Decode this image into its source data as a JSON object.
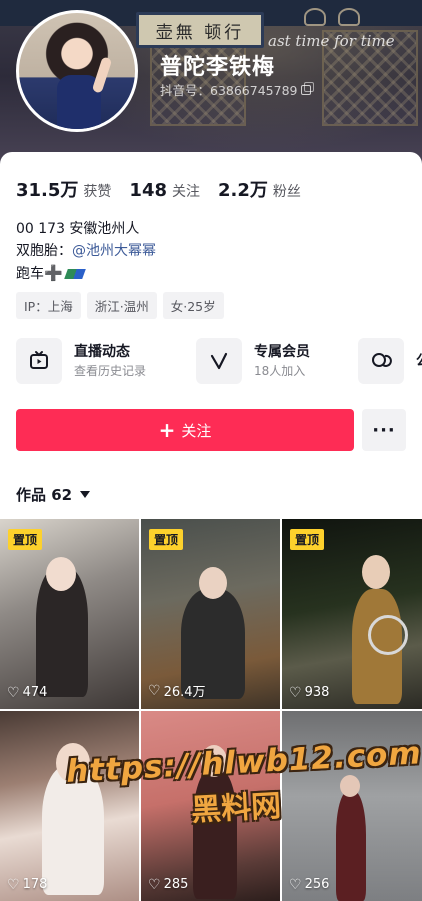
{
  "cover": {
    "plaque_text": "壶無 顿行",
    "script_text": "ast time for time"
  },
  "profile": {
    "nickname": "普陀李铁梅",
    "douyin_id": "抖音号：63866745789"
  },
  "stats": [
    {
      "value": "31.5万",
      "label": "获赞"
    },
    {
      "value": "148",
      "label": "关注"
    },
    {
      "value": "2.2万",
      "label": "粉丝"
    }
  ],
  "bio": {
    "line1": "00 173 安徽池州人",
    "line2_prefix": "双胞胎：",
    "line2_mention": "@池州大幂幂",
    "line3_text": "跑车",
    "line3_emoji": "➕"
  },
  "tags": [
    "IP：上海",
    "浙江·温州",
    "女·25岁"
  ],
  "features": [
    {
      "title": "直播动态",
      "subtitle": "查看历史记录",
      "icon": "tv-icon"
    },
    {
      "title": "专属会员",
      "subtitle": "18人加入",
      "icon": "v-icon"
    },
    {
      "title": "公",
      "subtitle": "",
      "icon": "chat-icon"
    }
  ],
  "actions": {
    "follow_label": "关注",
    "follow_plus": "+",
    "more_label": "···"
  },
  "works": {
    "label": "作品 62"
  },
  "videos": [
    {
      "pinned": "置顶",
      "likes": "474"
    },
    {
      "pinned": "置顶",
      "likes": "26.4万"
    },
    {
      "pinned": "置顶",
      "likes": "938"
    },
    {
      "pinned": "",
      "likes": "178"
    },
    {
      "pinned": "",
      "likes": "285"
    },
    {
      "pinned": "",
      "likes": "256"
    }
  ],
  "watermark": {
    "url": "https://hlwb12.com",
    "name": "黑料网"
  },
  "colors": {
    "accent": "#fe2c55",
    "pin_badge": "#fdd12c",
    "mention": "#3c5a98",
    "watermark": "#f0a640"
  }
}
